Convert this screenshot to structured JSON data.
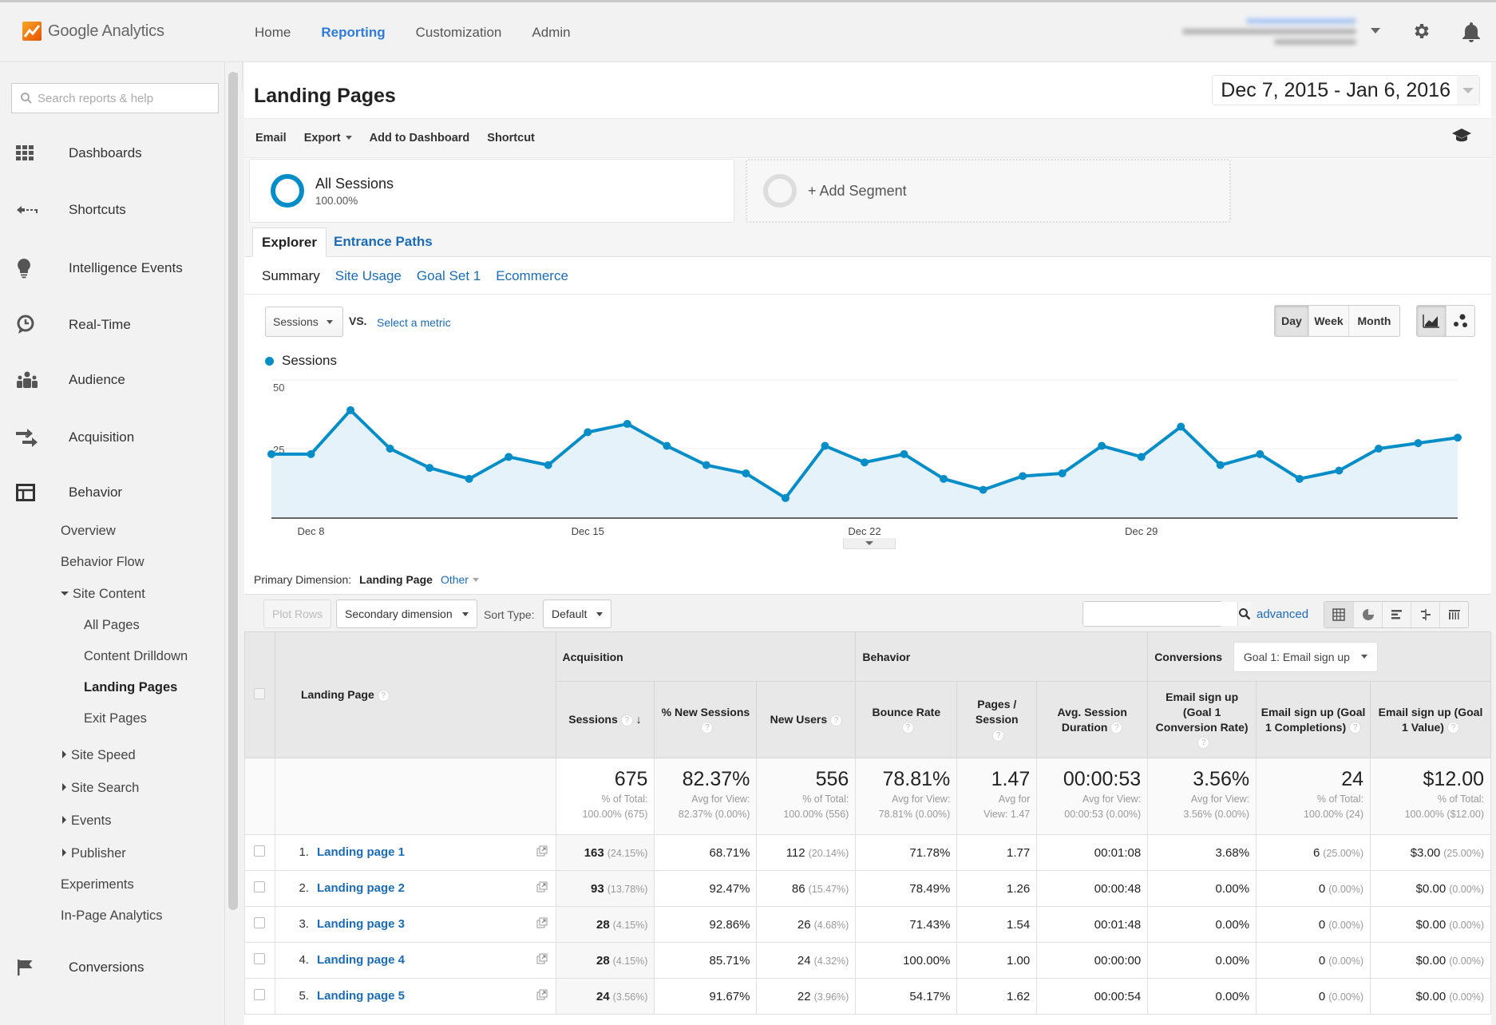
{
  "app": {
    "logo_text": "Google Analytics",
    "brand_colors": {
      "logo_orange": "#f57c00",
      "logo_yellow": "#f9a825",
      "accent_blue": "#2f7bd9",
      "link_blue": "#1b6bb6",
      "series_blue": "#058dc7"
    }
  },
  "topnav": {
    "items": [
      {
        "label": "Home",
        "active": false
      },
      {
        "label": "Reporting",
        "active": true
      },
      {
        "label": "Customization",
        "active": false
      },
      {
        "label": "Admin",
        "active": false
      }
    ],
    "account_info": "(blurred account email / property / view)"
  },
  "sidebar": {
    "search_placeholder": "Search reports & help",
    "items": [
      {
        "label": "Dashboards",
        "icon": "grid-icon"
      },
      {
        "label": "Shortcuts",
        "icon": "shortcut-arrow-icon"
      },
      {
        "label": "Intelligence Events",
        "icon": "lightbulb-icon"
      },
      {
        "label": "Real-Time",
        "icon": "clock-icon"
      },
      {
        "label": "Audience",
        "icon": "people-icon"
      },
      {
        "label": "Acquisition",
        "icon": "arrows-icon"
      },
      {
        "label": "Behavior",
        "icon": "layout-icon"
      },
      {
        "label": "Conversions",
        "icon": "flag-icon"
      }
    ],
    "behavior_sub": {
      "overview": "Overview",
      "behavior_flow": "Behavior Flow",
      "site_content": "Site Content",
      "site_content_children": [
        "All Pages",
        "Content Drilldown",
        "Landing Pages",
        "Exit Pages"
      ],
      "selected": "Landing Pages",
      "site_speed": "Site Speed",
      "site_search": "Site Search",
      "events": "Events",
      "publisher": "Publisher",
      "experiments": "Experiments",
      "in_page": "In-Page Analytics"
    }
  },
  "report": {
    "title": "Landing Pages",
    "date_range": "Dec 7, 2015 - Jan 6, 2016",
    "toolbar": {
      "email": "Email",
      "export": "Export",
      "add_to_dashboard": "Add to Dashboard",
      "shortcut": "Shortcut"
    },
    "segments": {
      "all_sessions": "All Sessions",
      "all_sessions_pct": "100.00%",
      "add_segment": "+ Add Segment"
    },
    "tabs": {
      "explorer": "Explorer",
      "entrance_paths": "Entrance Paths"
    },
    "subtabs": [
      "Summary",
      "Site Usage",
      "Goal Set 1",
      "Ecommerce"
    ],
    "metric_select": "Sessions",
    "vs": "VS.",
    "select_metric": "Select a metric",
    "granularity": [
      "Day",
      "Week",
      "Month"
    ],
    "granularity_selected": "Day"
  },
  "chart_data": {
    "type": "area",
    "title": "",
    "series": [
      {
        "name": "Sessions",
        "color": "#058dc7",
        "values": [
          23,
          23,
          39,
          25,
          18,
          14,
          22,
          19,
          31,
          34,
          26,
          19,
          16,
          7,
          26,
          20,
          23,
          14,
          10,
          15,
          16,
          26,
          22,
          33,
          19,
          23,
          14,
          17,
          25,
          27,
          29
        ]
      }
    ],
    "x": [
      "Dec 7",
      "Dec 8",
      "Dec 9",
      "Dec 10",
      "Dec 11",
      "Dec 12",
      "Dec 13",
      "Dec 14",
      "Dec 15",
      "Dec 16",
      "Dec 17",
      "Dec 18",
      "Dec 19",
      "Dec 20",
      "Dec 21",
      "Dec 22",
      "Dec 23",
      "Dec 24",
      "Dec 25",
      "Dec 26",
      "Dec 27",
      "Dec 28",
      "Dec 29",
      "Dec 30",
      "Dec 31",
      "Jan 1",
      "Jan 2",
      "Jan 3",
      "Jan 4",
      "Jan 5",
      "Jan 6"
    ],
    "x_tick_labels": [
      "Dec 8",
      "Dec 15",
      "Dec 22",
      "Dec 29"
    ],
    "y_tick_labels": [
      "25",
      "50"
    ],
    "ylim": [
      0,
      50
    ],
    "legend": "top-left",
    "grid": true,
    "xlabel": "",
    "ylabel": ""
  },
  "table_controls": {
    "primary_dimension_label": "Primary Dimension:",
    "primary_dimension": "Landing Page",
    "other": "Other",
    "plot_rows": "Plot Rows",
    "secondary_dimension": "Secondary dimension",
    "sort_type_label": "Sort Type:",
    "sort_type": "Default",
    "search_value": "",
    "advanced": "advanced"
  },
  "table": {
    "dimension_header": "Landing Page",
    "groups": {
      "acquisition": "Acquisition",
      "behavior": "Behavior",
      "conversions": "Conversions",
      "goal_select": "Goal 1: Email sign up"
    },
    "columns": [
      "Sessions",
      "% New Sessions",
      "New Users",
      "Bounce Rate",
      "Pages / Session",
      "Avg. Session Duration",
      "Email sign up (Goal 1 Conversion Rate)",
      "Email sign up (Goal 1 Completions)",
      "Email sign up (Goal 1 Value)"
    ],
    "totals": [
      {
        "value": "675",
        "sub1": "% of Total:",
        "sub2": "100.00% (675)"
      },
      {
        "value": "82.37%",
        "sub1": "Avg for View:",
        "sub2": "82.37% (0.00%)"
      },
      {
        "value": "556",
        "sub1": "% of Total:",
        "sub2": "100.00% (556)"
      },
      {
        "value": "78.81%",
        "sub1": "Avg for View:",
        "sub2": "78.81% (0.00%)"
      },
      {
        "value": "1.47",
        "sub1": "Avg for",
        "sub2": "View: 1.47"
      },
      {
        "value": "00:00:53",
        "sub1": "Avg for View:",
        "sub2": "00:00:53 (0.00%)"
      },
      {
        "value": "3.56%",
        "sub1": "Avg for View:",
        "sub2": "3.56% (0.00%)"
      },
      {
        "value": "24",
        "sub1": "% of Total:",
        "sub2": "100.00% (24)"
      },
      {
        "value": "$12.00",
        "sub1": "% of Total:",
        "sub2": "100.00% ($12.00)"
      }
    ],
    "rows": [
      {
        "idx": "1.",
        "page": "Landing page 1",
        "sessions": "163",
        "sessions_pct": "(24.15%)",
        "new_sessions": "68.71%",
        "new_users": "112",
        "new_users_pct": "(20.14%)",
        "bounce": "71.78%",
        "pps": "1.77",
        "duration": "00:01:08",
        "conv_rate": "3.68%",
        "completions": "6",
        "completions_pct": "(25.00%)",
        "value": "$3.00",
        "value_pct": "(25.00%)"
      },
      {
        "idx": "2.",
        "page": "Landing page 2",
        "sessions": "93",
        "sessions_pct": "(13.78%)",
        "new_sessions": "92.47%",
        "new_users": "86",
        "new_users_pct": "(15.47%)",
        "bounce": "78.49%",
        "pps": "1.26",
        "duration": "00:00:48",
        "conv_rate": "0.00%",
        "completions": "0",
        "completions_pct": "(0.00%)",
        "value": "$0.00",
        "value_pct": "(0.00%)"
      },
      {
        "idx": "3.",
        "page": "Landing page 3",
        "sessions": "28",
        "sessions_pct": "(4.15%)",
        "new_sessions": "92.86%",
        "new_users": "26",
        "new_users_pct": "(4.68%)",
        "bounce": "71.43%",
        "pps": "1.54",
        "duration": "00:01:48",
        "conv_rate": "0.00%",
        "completions": "0",
        "completions_pct": "(0.00%)",
        "value": "$0.00",
        "value_pct": "(0.00%)"
      },
      {
        "idx": "4.",
        "page": "Landing page 4",
        "sessions": "28",
        "sessions_pct": "(4.15%)",
        "new_sessions": "85.71%",
        "new_users": "24",
        "new_users_pct": "(4.32%)",
        "bounce": "100.00%",
        "pps": "1.00",
        "duration": "00:00:00",
        "conv_rate": "0.00%",
        "completions": "0",
        "completions_pct": "(0.00%)",
        "value": "$0.00",
        "value_pct": "(0.00%)"
      },
      {
        "idx": "5.",
        "page": "Landing page 5",
        "sessions": "24",
        "sessions_pct": "(3.56%)",
        "new_sessions": "91.67%",
        "new_users": "22",
        "new_users_pct": "(3.96%)",
        "bounce": "54.17%",
        "pps": "1.62",
        "duration": "00:00:54",
        "conv_rate": "0.00%",
        "completions": "0",
        "completions_pct": "(0.00%)",
        "value": "$0.00",
        "value_pct": "(0.00%)"
      }
    ]
  }
}
